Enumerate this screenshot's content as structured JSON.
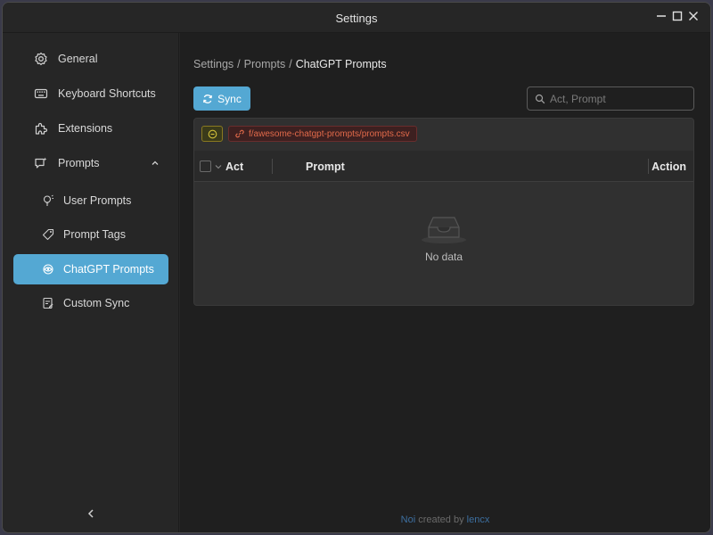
{
  "window": {
    "title": "Settings"
  },
  "sidebar": {
    "items": [
      {
        "label": "General",
        "icon": "gear-icon"
      },
      {
        "label": "Keyboard Shortcuts",
        "icon": "keyboard-icon"
      },
      {
        "label": "Extensions",
        "icon": "puzzle-icon"
      },
      {
        "label": "Prompts",
        "icon": "chat-bubble-icon",
        "expanded": true
      },
      {
        "label": "User Prompts",
        "icon": "lightbulb-icon"
      },
      {
        "label": "Prompt Tags",
        "icon": "tag-icon"
      },
      {
        "label": "ChatGPT Prompts",
        "icon": "openai-icon",
        "active": true
      },
      {
        "label": "Custom Sync",
        "icon": "document-edit-icon"
      }
    ]
  },
  "breadcrumb": {
    "items": [
      "Settings",
      "Prompts",
      "ChatGPT Prompts"
    ],
    "separator": "/"
  },
  "toolbar": {
    "sync_label": "Sync",
    "search_placeholder": "Act, Prompt"
  },
  "source": {
    "path": "f/awesome-chatgpt-prompts/prompts.csv"
  },
  "table": {
    "columns": [
      "Act",
      "Prompt",
      "Action"
    ],
    "empty_text": "No data",
    "rows": []
  },
  "footer": {
    "app": "Noi",
    "text": "created by",
    "author": "lencx"
  },
  "colors": {
    "accent": "#54a8d3",
    "source_tag": "#e26a4a",
    "toggle_border": "#8a7a20"
  }
}
